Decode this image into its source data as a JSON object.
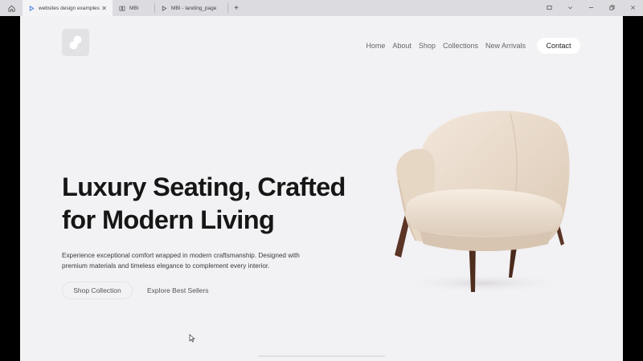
{
  "browser": {
    "tabs": [
      {
        "label": "websites design examples",
        "active": true,
        "icon": "play-icon"
      },
      {
        "label": "MBI",
        "active": false,
        "icon": "book-icon"
      },
      {
        "label": "MBI - landing_page",
        "active": false,
        "icon": "play-icon"
      }
    ],
    "new_tab_symbol": "+",
    "controls": [
      "minimize",
      "maximize",
      "close"
    ]
  },
  "nav": {
    "links": [
      "Home",
      "About",
      "Shop",
      "Collections",
      "New Arrivals"
    ],
    "contact_label": "Contact"
  },
  "hero": {
    "title_line1": "Luxury Seating, Crafted",
    "title_line2": "for Modern Living",
    "description": "Experience exceptional comfort wrapped in modern craftsmanship. Designed with premium materials and timeless elegance to complement every interior.",
    "primary_button": "Shop Collection",
    "secondary_button": "Explore Best Sellers"
  },
  "colors": {
    "background": "#f2f1f3",
    "text": "#161616",
    "chair_fabric": "#ebdccc",
    "chair_legs": "#5a3424"
  }
}
